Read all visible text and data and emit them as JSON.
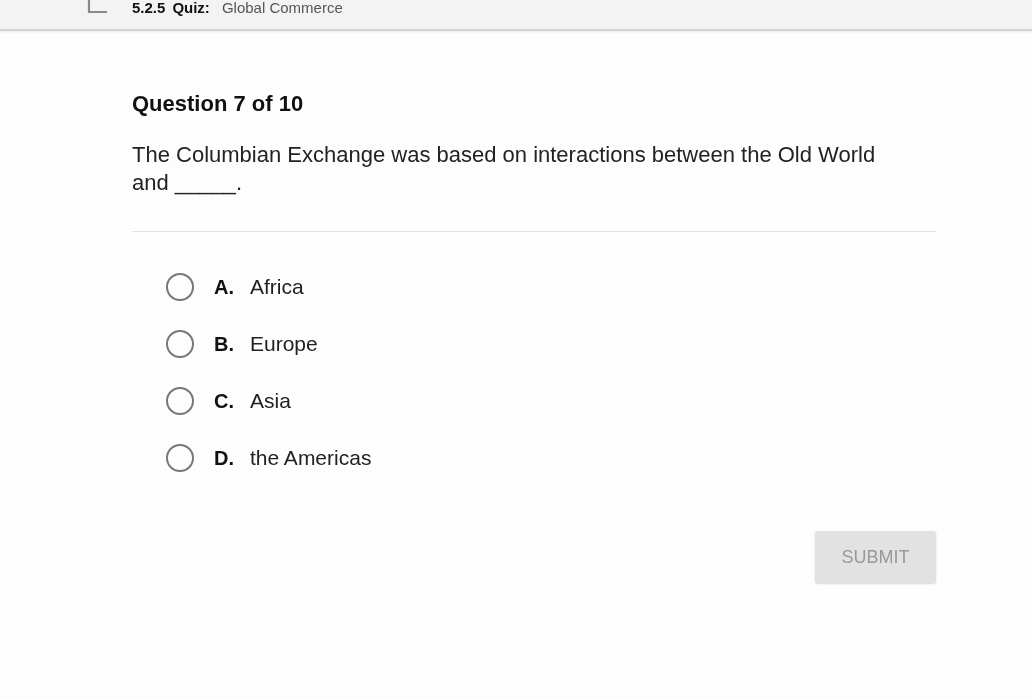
{
  "header": {
    "quiz_number": "5.2.5",
    "quiz_label": "Quiz:",
    "title": "Global Commerce"
  },
  "question": {
    "heading": "Question 7 of 10",
    "text": "The Columbian Exchange was based on interactions between the Old World and _____."
  },
  "options": [
    {
      "letter": "A.",
      "text": "Africa",
      "selected": false
    },
    {
      "letter": "B.",
      "text": "Europe",
      "selected": false
    },
    {
      "letter": "C.",
      "text": "Asia",
      "selected": false
    },
    {
      "letter": "D.",
      "text": "the Americas",
      "selected": false
    }
  ],
  "submit": {
    "label": "SUBMIT",
    "disabled": true
  }
}
